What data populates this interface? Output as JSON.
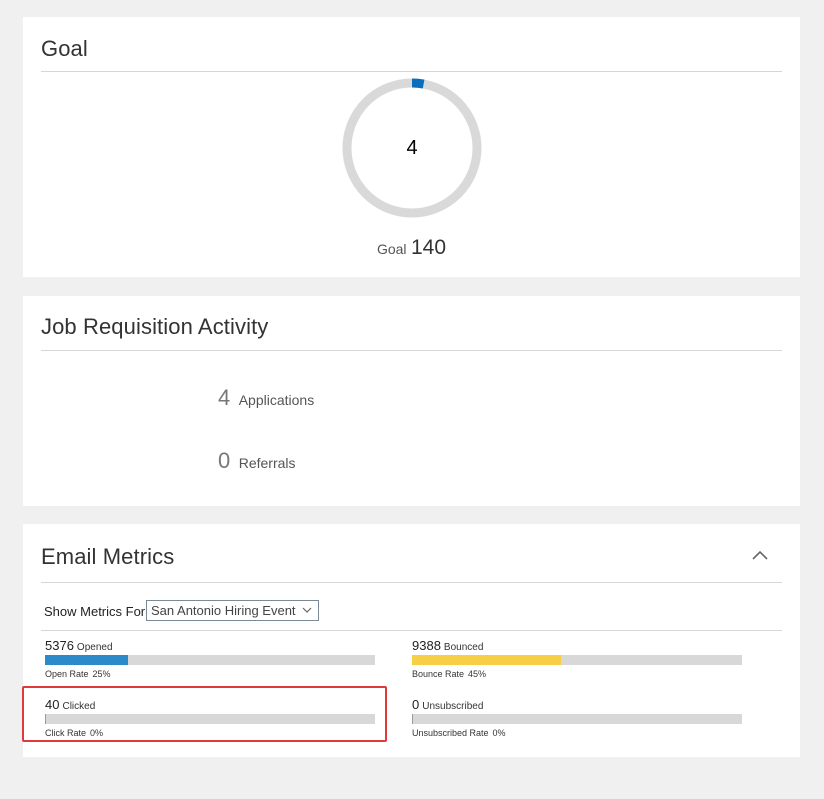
{
  "goal": {
    "title": "Goal",
    "current": "4",
    "current_value": 4,
    "goal_label": "Goal",
    "goal_value": "140",
    "goal_target": 140,
    "ring_color": "#0a6ebd",
    "ring_track_color": "#d9d9d9"
  },
  "job_requisition": {
    "title": "Job Requisition Activity",
    "stats": [
      {
        "count": "4",
        "label": "Applications"
      },
      {
        "count": "0",
        "label": "Referrals"
      }
    ]
  },
  "email_metrics": {
    "title": "Email Metrics",
    "collapse_icon": "chevron-up-icon",
    "filter": {
      "label": "Show Metrics For",
      "selected": "San Antonio Hiring Event",
      "icon": "chevron-down-icon"
    },
    "metrics": [
      {
        "count": "5376",
        "name": "Opened",
        "rate_label": "Open Rate",
        "rate": "25%",
        "fill": 0.25,
        "color": "#2b8ac9"
      },
      {
        "count": "9388",
        "name": "Bounced",
        "rate_label": "Bounce Rate",
        "rate": "45%",
        "fill": 0.45,
        "color": "#f6cf45"
      },
      {
        "count": "40",
        "name": "Clicked",
        "rate_label": "Click Rate",
        "rate": "0%",
        "fill": 0.0,
        "color": "#9a9a9a"
      },
      {
        "count": "0",
        "name": "Unsubscribed",
        "rate_label": "Unsubscribed Rate",
        "rate": "0%",
        "fill": 0.0,
        "color": "#9a9a9a"
      }
    ],
    "highlight_color": "#e0393b"
  }
}
